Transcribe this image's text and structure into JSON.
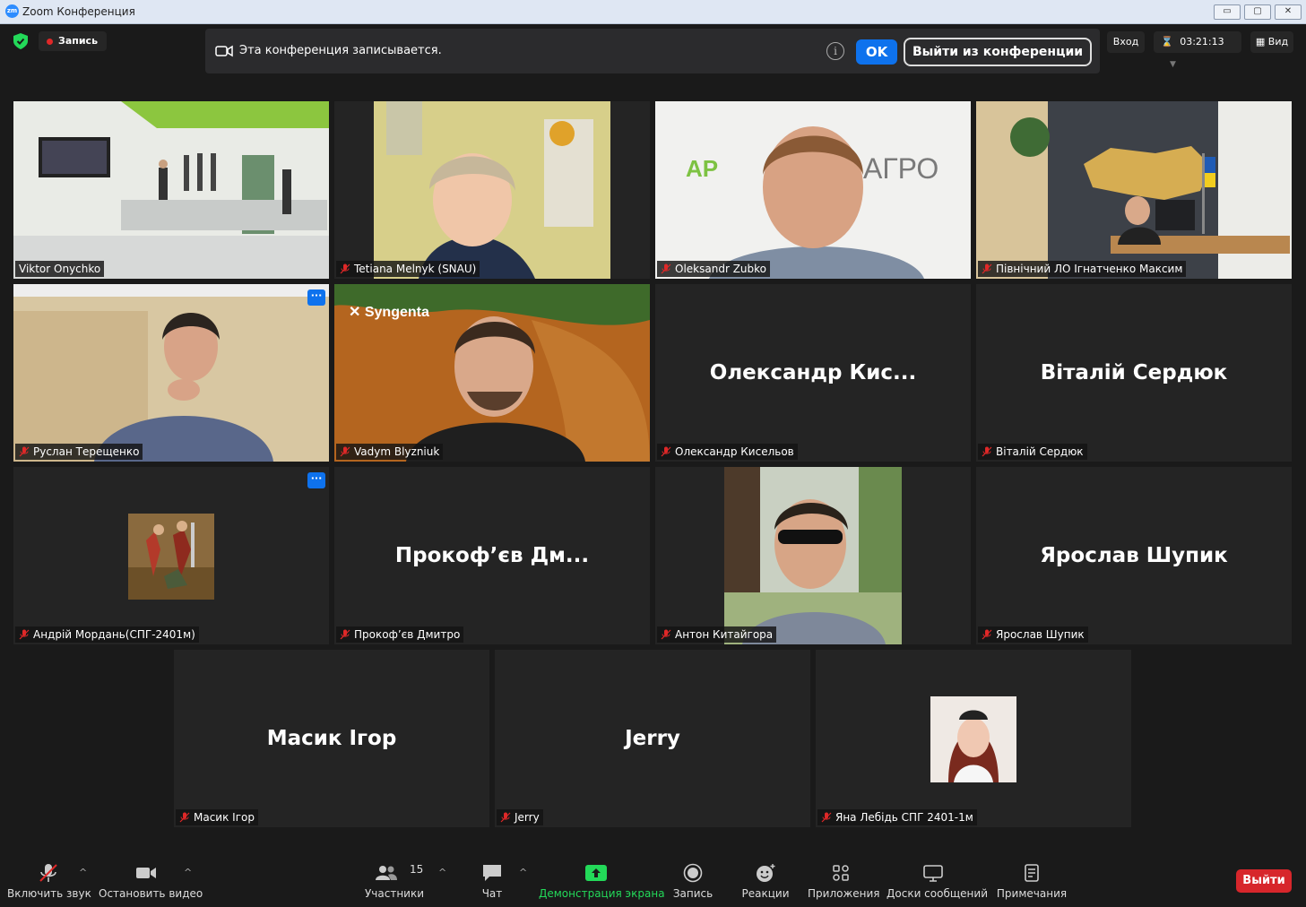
{
  "window": {
    "title": "Zoom Конференция",
    "logo_text": "zm",
    "minimize": "▭",
    "maximize": "▢",
    "close": "✕"
  },
  "topbar": {
    "record_label": "Запись",
    "banner_message": "Эта конференция записывается.",
    "info_glyph": "i",
    "ok_label": "OK",
    "leave_conference_label": "Выйти из конференции",
    "login_label": "Вход",
    "timer": "03:21:13",
    "view_label": "Вид"
  },
  "tiles": [
    {
      "label": "Viktor Onychko",
      "big": "",
      "active": true,
      "video": "room",
      "muted": false
    },
    {
      "label": "Tetiana Melnyk (SNAU)",
      "big": "",
      "video": "woman",
      "muted": true
    },
    {
      "label": "Oleksandr Zubko",
      "big": "",
      "video": "man_agro",
      "muted": true
    },
    {
      "label": "Північний ЛО Ігнатченко Максим",
      "big": "",
      "video": "office_map",
      "muted": true
    },
    {
      "label": "Руслан Терещенко",
      "big": "",
      "video": "man_room",
      "muted": true,
      "menu": true
    },
    {
      "label": "Vadym Blyzniuk",
      "big": "",
      "video": "syngenta",
      "muted": true
    },
    {
      "label": "Олександр Кисельов",
      "big": "Олександр  Кис...",
      "muted": true
    },
    {
      "label": "Віталій Сердюк",
      "big": "Віталій Сердюк",
      "muted": true
    },
    {
      "label": "Андрій Мордань(СПГ-2401м)",
      "big": "",
      "video": "painting",
      "muted": true,
      "menu": true
    },
    {
      "label": "Прокоф’єв Дмитро",
      "big": "Прокоф’єв Дм...",
      "muted": true
    },
    {
      "label": "Антон Китайгора",
      "big": "",
      "video": "man_sun",
      "muted": true
    },
    {
      "label": "Ярослав Шупик",
      "big": "Ярослав Шупик",
      "muted": true
    },
    {
      "label": "Масик Ігор",
      "big": "Масик Ігор",
      "muted": true
    },
    {
      "label": "Jerry",
      "big": "Jerry",
      "muted": true
    },
    {
      "label": "Яна Лебідь СПГ 2401-1м",
      "big": "",
      "video": "girl",
      "muted": true
    }
  ],
  "toolbar": {
    "unmute": "Включить звук",
    "stop_video": "Остановить видео",
    "participants": "Участники",
    "participants_count": "15",
    "chat": "Чат",
    "share": "Демонстрация экрана",
    "record": "Запись",
    "reactions": "Реакции",
    "apps": "Приложения",
    "whiteboards": "Доски сообщений",
    "notes": "Примечания",
    "leave": "Выйти"
  },
  "colors": {
    "share_green": "#23d959",
    "ok_blue": "#0e72ed",
    "leave_red": "#d7262b",
    "active_border": "#e8ee8a"
  }
}
